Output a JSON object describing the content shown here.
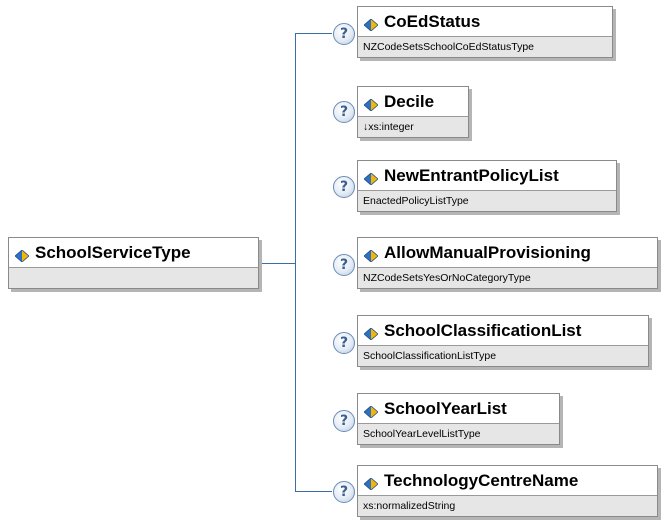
{
  "root": {
    "name": "SchoolServiceType",
    "type": ""
  },
  "children": [
    {
      "name": "CoEdStatus",
      "type": "NZCodeSetsSchoolCoEdStatusType"
    },
    {
      "name": "Decile",
      "type": "↓xs:integer"
    },
    {
      "name": "NewEntrantPolicyList",
      "type": "EnactedPolicyListType"
    },
    {
      "name": "AllowManualProvisioning",
      "type": "NZCodeSetsYesOrNoCategoryType"
    },
    {
      "name": "SchoolClassificationList",
      "type": "SchoolClassificationListType"
    },
    {
      "name": "SchoolYearList",
      "type": "SchoolYearLevelListType"
    },
    {
      "name": "TechnologyCentreName",
      "type": "xs:normalizedString"
    }
  ],
  "help_glyph": "?",
  "icon": "element-diamond-icon",
  "colors": {
    "connector": "#3b6ea5",
    "type_bg": "#e6e6e6",
    "border": "#8a8a8a",
    "icon_blue": "#2f6fc4",
    "icon_gold": "#f2b705"
  }
}
